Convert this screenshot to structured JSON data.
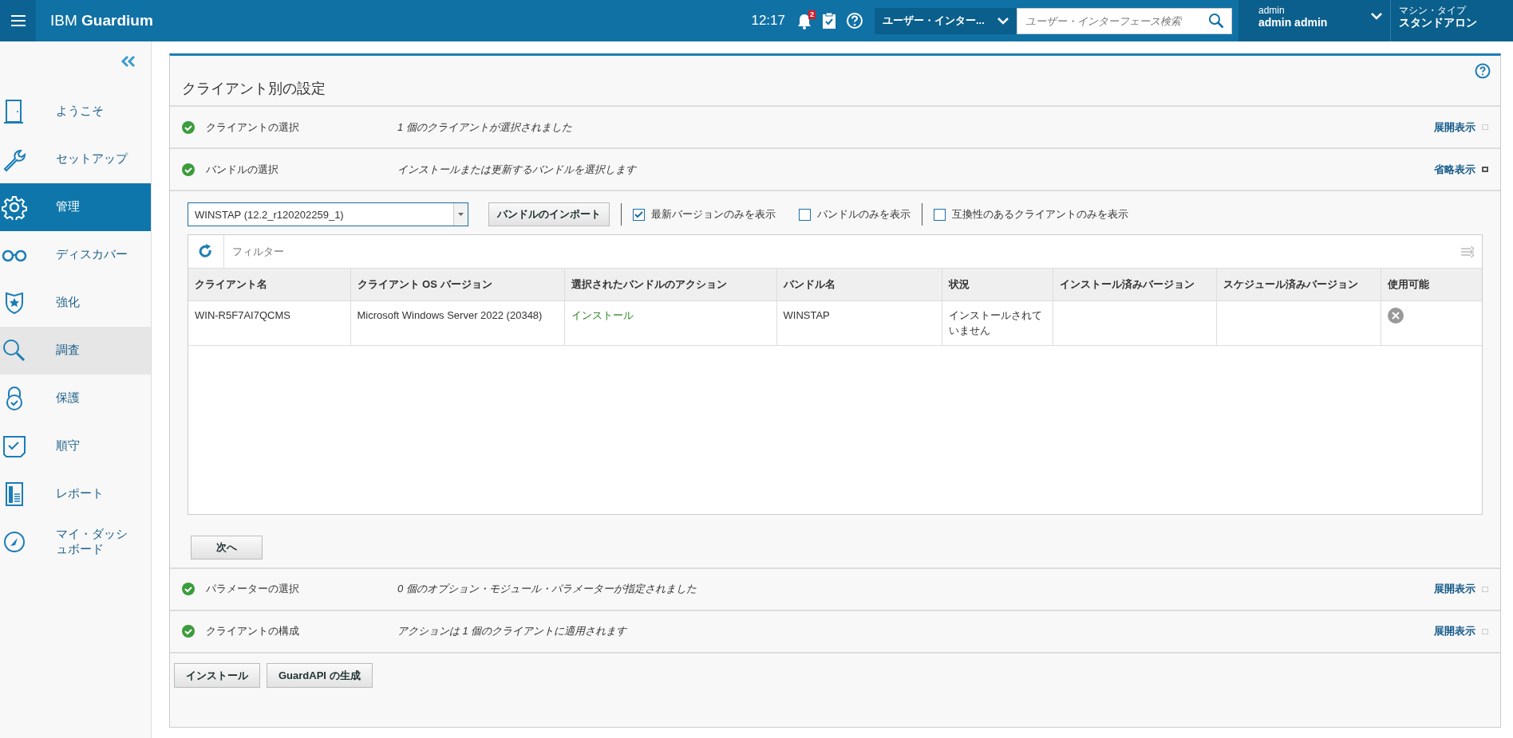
{
  "header": {
    "brand_prefix": "IBM",
    "brand": "Guardium",
    "time": "12:17",
    "notification_count": "2",
    "ui_dropdown": "ユーザー・インター...",
    "search": {
      "placeholder": "ユーザー・インターフェース検索"
    },
    "user": {
      "role": "admin",
      "name": "admin admin"
    },
    "machine": {
      "label": "マシン・タイプ",
      "value": "スタンドアロン"
    }
  },
  "sidebar": {
    "items": [
      {
        "label": "ようこそ",
        "kind": "door",
        "selected": false,
        "hovered": false
      },
      {
        "label": "セットアップ",
        "kind": "wrench",
        "selected": false,
        "hovered": false
      },
      {
        "label": "管理",
        "kind": "gear",
        "selected": true,
        "hovered": false
      },
      {
        "label": "ディスカバー",
        "kind": "glasses",
        "selected": false,
        "hovered": false
      },
      {
        "label": "強化",
        "kind": "shield",
        "selected": false,
        "hovered": false
      },
      {
        "label": "調査",
        "kind": "search",
        "selected": false,
        "hovered": true
      },
      {
        "label": "保護",
        "kind": "lock",
        "selected": false,
        "hovered": false
      },
      {
        "label": "順守",
        "kind": "checklist",
        "selected": false,
        "hovered": false
      },
      {
        "label": "レポート",
        "kind": "report",
        "selected": false,
        "hovered": false
      },
      {
        "label": "マイ・ダッシュボード",
        "kind": "gauge",
        "selected": false,
        "hovered": false
      }
    ]
  },
  "panel": {
    "title": "クライアント別の設定",
    "steps": [
      {
        "label": "クライアントの選択",
        "summary": "1 個のクライアントが選択されました",
        "toggle": "展開表示",
        "expanded": false
      },
      {
        "label": "バンドルの選択",
        "summary": "インストールまたは更新するバンドルを選択します",
        "toggle": "省略表示",
        "expanded": true,
        "content": {
          "bundle_select": "WINSTAP (12.2_r120202259_1)",
          "import_button": "バンドルのインポート",
          "options": [
            {
              "label": "最新バージョンのみを表示",
              "checked": true
            },
            {
              "label": "バンドルのみを表示",
              "checked": false
            },
            {
              "label": "互換性のあるクライアントのみを表示",
              "checked": false
            }
          ],
          "filter": {
            "placeholder": "フィルター"
          },
          "table": {
            "columns": [
              "クライアント名",
              "クライアント OS バージョン",
              "選択されたバンドルのアクション",
              "バンドル名",
              "状況",
              "インストール済みバージョン",
              "スケジュール済みバージョン",
              "使用可能"
            ],
            "rows": [
              {
                "client": "WIN-R5F7AI7QCMS",
                "os_version": "Microsoft Windows Server 2022 (20348)",
                "action": "インストール",
                "bundle": "WINSTAP",
                "status": "インストールされていません",
                "available": false
              }
            ]
          },
          "next_button": "次へ"
        }
      },
      {
        "label": "パラメーターの選択",
        "summary": "0 個のオプション・モジュール・パラメーターが指定されました",
        "toggle": "展開表示",
        "expanded": false
      },
      {
        "label": "クライアントの構成",
        "summary": "アクションは 1 個のクライアントに適用されます",
        "toggle": "展開表示",
        "expanded": false
      }
    ],
    "buttons": [
      "インストール",
      "GuardAPI の生成"
    ]
  }
}
